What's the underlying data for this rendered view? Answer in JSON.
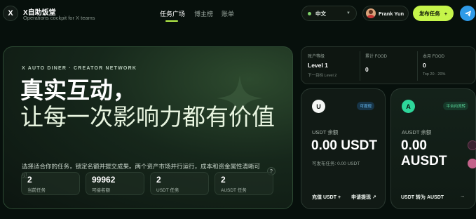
{
  "brand": {
    "logo_letter": "X",
    "title": "X自助饭堂",
    "subtitle": "Operations cockpit for X teams"
  },
  "nav": {
    "tabs": [
      {
        "label": "任务广场",
        "active": true
      },
      {
        "label": "博主榜"
      },
      {
        "label": "账单"
      }
    ]
  },
  "header": {
    "language": "中文",
    "user_name": "Frank Yun",
    "publish_label": "发布任务",
    "publish_plus": "+",
    "accent_color": "#c5f54a",
    "send_icon": "send-icon"
  },
  "hero": {
    "eyebrow": "X AUTO DINER · CREATOR NETWORK",
    "headline": "真实互动，",
    "subheadline": "让每一次影响力都有价值",
    "description": "选择适合你的任务，锁定名额并提交成果。两个资产市场并行运行，成本和资金属性清晰可见。",
    "help_icon": "?",
    "stats": [
      {
        "value": "2",
        "label": "当前任务"
      },
      {
        "value": "99962",
        "label": "可接名额"
      },
      {
        "value": "2",
        "label": "USDT 任务"
      },
      {
        "value": "2",
        "label": "AUSDT 任务"
      }
    ]
  },
  "metrics": [
    {
      "label": "账户等级",
      "value": "Level 1",
      "sub": "下一目标 Level 2"
    },
    {
      "label": "累计 FOOD",
      "value": "0",
      "sub": ""
    },
    {
      "label": "本月 FOOD",
      "value": "0",
      "sub": "Top 20 · 20%"
    }
  ],
  "wallets": {
    "usdt": {
      "coin_letter": "U",
      "tag": "可提现",
      "label": "USDT 余额",
      "balance": "0.00 USDT",
      "note": "可发布任务: 0.00 USDT",
      "action_1": "充值 USDT +",
      "action_2": "申请提现 ↗"
    },
    "ausdt": {
      "coin_letter": "A",
      "tag": "平台内流转",
      "label": "AUSDT 余额",
      "balance_line1": "0.00",
      "balance_line2": "AUSDT",
      "action_1": "USDT 转为 AUSDT",
      "action_arrow": "→"
    }
  }
}
